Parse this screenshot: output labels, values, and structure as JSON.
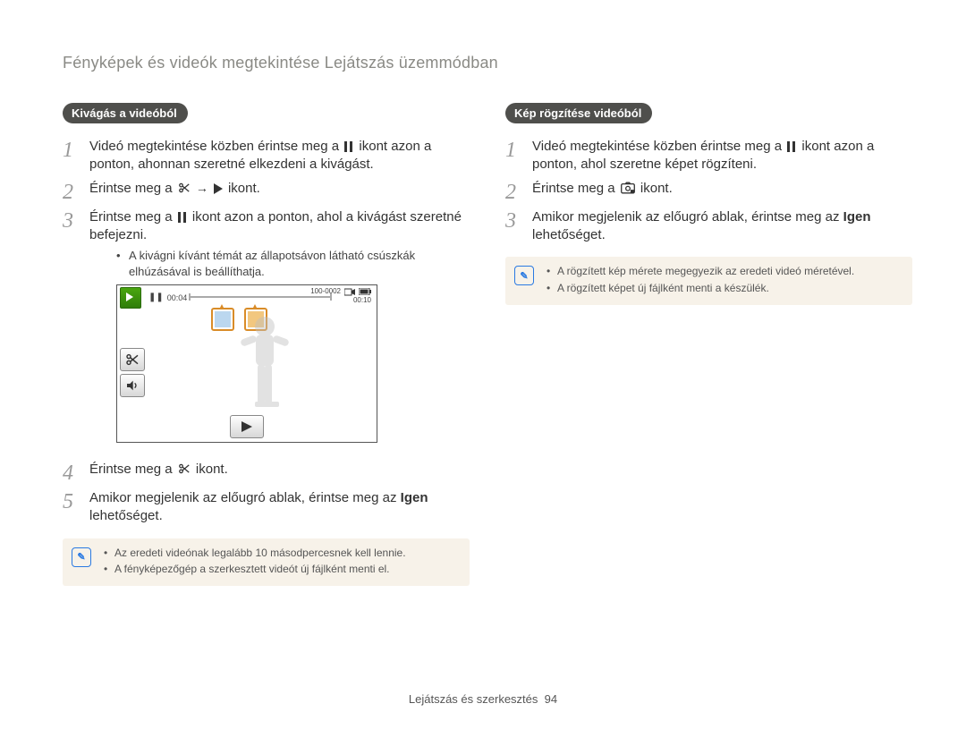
{
  "section_title": "Fényképek és videók megtekintése Lejátszás üzemmódban",
  "footer": {
    "label": "Lejátszás és szerkesztés",
    "page": "94"
  },
  "left": {
    "tag": "Kivágás a videóból",
    "steps": {
      "s1_a": "Videó megtekintése közben érintse meg a ",
      "s1_b": " ikont azon a ponton, ahonnan szeretné elkezdeni a kivágást.",
      "s2_a": "Érintse meg a ",
      "s2_b": " → ",
      "s2_c": " ikont.",
      "s3_a": "Érintse meg a ",
      "s3_b": " ikont azon a ponton, ahol a kivágást szeretné befejezni.",
      "s3_bullet": "A kivágni kívánt témát az állapotsávon látható csúszkák elhúzásával is beállíthatja.",
      "s4_a": "Érintse meg a ",
      "s4_b": " ikont.",
      "s5": "Amikor megjelenik az előugró ablak, érintse meg az ",
      "s5_bold": "Igen",
      "s5_after": " lehetőséget."
    },
    "note": {
      "b1": "Az eredeti videónak legalább 10 másodpercesnek kell lennie.",
      "b2": "A fényképezőgép a szerkesztett videót új fájlként menti el."
    },
    "figure": {
      "timestamp_in": "00:04",
      "file_id": "100-0002",
      "timestamp_total": "00:10"
    }
  },
  "right": {
    "tag": "Kép rögzítése videóból",
    "steps": {
      "s1_a": "Videó megtekintése közben érintse meg a ",
      "s1_b": " ikont azon a ponton, ahol szeretne képet rögzíteni.",
      "s2_a": "Érintse meg a ",
      "s2_b": " ikont.",
      "s3": "Amikor megjelenik az előugró ablak, érintse meg az ",
      "s3_bold": "Igen",
      "s3_after": " lehetőséget."
    },
    "note": {
      "b1": "A rögzített kép mérete megegyezik az eredeti videó méretével.",
      "b2": "A rögzített képet új fájlként menti a készülék."
    }
  }
}
